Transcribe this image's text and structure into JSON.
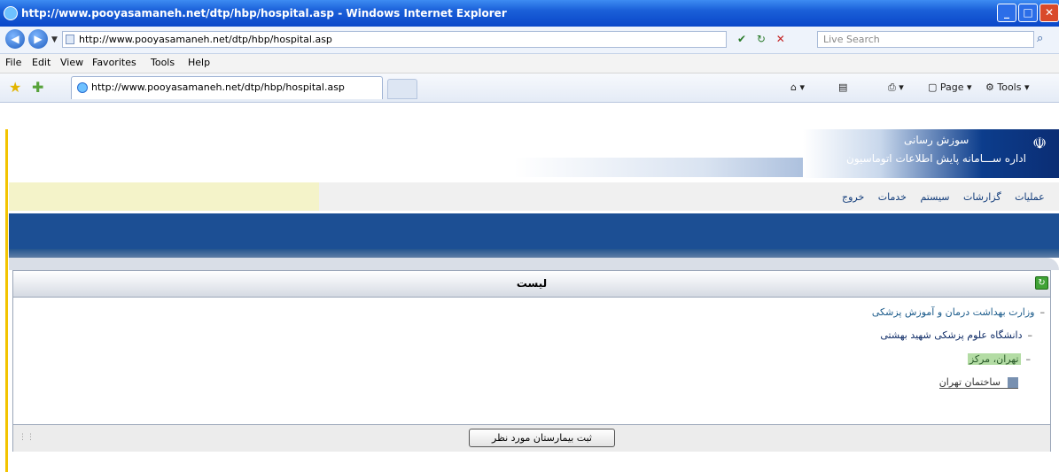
{
  "window": {
    "title": "http://www.pooyasamaneh.net/dtp/hbp/hospital.asp - Windows Internet Explorer",
    "minimize": "_",
    "maximize": "□",
    "close": "✕"
  },
  "addressbar": {
    "back_icon": "back-arrow-icon",
    "forward_icon": "forward-arrow-icon",
    "url": "http://www.pooyasamaneh.net/dtp/hbp/hospital.asp",
    "search_placeholder": "Live Search",
    "go_glyph": "✔",
    "refresh_glyph": "↻",
    "stop_glyph": "✕",
    "search_glyph": "⌕"
  },
  "menubar": {
    "items": [
      "File",
      "Edit",
      "View",
      "Favorites",
      "Tools",
      "Help"
    ]
  },
  "favbar": {
    "tab_title": "http://www.pooyasamaneh.net/dtp/hbp/hospital.asp",
    "page_label": "Page",
    "tools_label": "Tools"
  },
  "site": {
    "banner_title": "سوزش رسانی",
    "banner_subtitle": "اداره ســـامانه پایش اطلاعات اتوماسیون",
    "menu": [
      "عملیات",
      "گزارشات",
      "سیستم",
      "خدمات",
      "خروج"
    ]
  },
  "panel": {
    "title": "لیست",
    "tree": [
      "وزارت بهداشت درمان و آموزش پزشکی",
      "دانشگاه علوم پزشکی شهید بهشتی",
      "تهران، مرکز",
      "ساختمان تهران"
    ],
    "submit_label": "ثبت بیمارستان مورد نظر"
  },
  "colors": {
    "titlebar": "#1a5fd8",
    "site_blue": "#1c4f94",
    "accent_yellow": "#f3c400"
  }
}
